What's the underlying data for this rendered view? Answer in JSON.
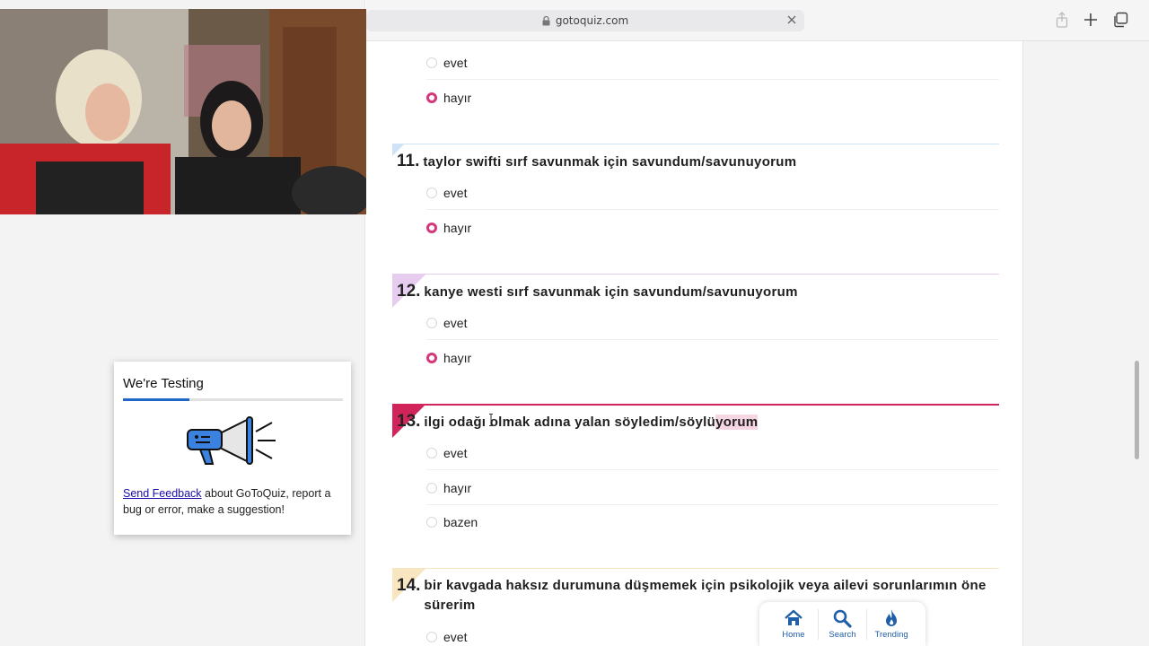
{
  "browser": {
    "url": "gotoquiz.com"
  },
  "testing_card": {
    "title": "We're Testing",
    "progress": 0.3,
    "link_text": "Send Feedback",
    "body_text": " about GoToQuiz, report a bug or error, make a suggestion!"
  },
  "questions": [
    {
      "number": "",
      "text": "",
      "answers": [
        {
          "label": "evet",
          "checked": false
        },
        {
          "label": "hayır",
          "checked": true
        }
      ]
    },
    {
      "number": "11.",
      "text": "taylor swifti sırf savunmak için savundum/savunuyorum",
      "accent": "#cfe3f7",
      "answers": [
        {
          "label": "evet",
          "checked": false
        },
        {
          "label": "hayır",
          "checked": true
        }
      ]
    },
    {
      "number": "12.",
      "text": "kanye westi sırf savunmak için savundum/savunuyorum",
      "accent": "#e6cdf0",
      "answers": [
        {
          "label": "evet",
          "checked": false
        },
        {
          "label": "hayır",
          "checked": true
        }
      ]
    },
    {
      "number": "13.",
      "text_before": "ilgi odağı olmak adına yalan söyledim/söylü",
      "text_highlight": "yorum",
      "accent": "#d0245a",
      "answers": [
        {
          "label": "evet",
          "checked": false
        },
        {
          "label": "hayır",
          "checked": false
        },
        {
          "label": "bazen",
          "checked": false
        }
      ]
    },
    {
      "number": "14.",
      "text": "bir kavgada haksız durumuna düşmemek için psikolojik veya ailevi sorunlarımın öne sürerim",
      "accent": "#f7e6bf",
      "answers": [
        {
          "label": "evet",
          "checked": false
        }
      ]
    }
  ],
  "bottom_nav": {
    "items": [
      {
        "label": "Home",
        "icon": "home-icon"
      },
      {
        "label": "Search",
        "icon": "search-icon"
      },
      {
        "label": "Trending",
        "icon": "flame-icon"
      }
    ],
    "color": "#1f5ea8"
  },
  "colors": {
    "radio_checked": "#d4377a",
    "link": "#1a0dab",
    "progress": "#1f68c9"
  }
}
